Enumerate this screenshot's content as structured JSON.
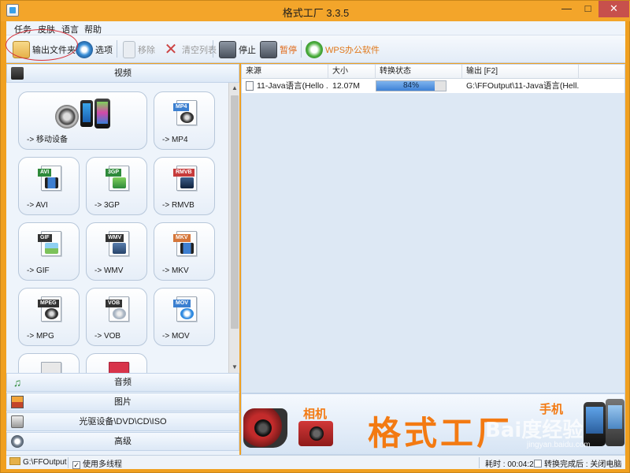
{
  "window": {
    "title": "格式工厂 3.3.5",
    "controls": {
      "minimize": "—",
      "maximize": "□",
      "close": "✕"
    }
  },
  "menu": [
    "任务",
    "皮肤",
    "语言",
    "帮助"
  ],
  "toolbar": {
    "output_folder": "输出文件夹",
    "options": "选项",
    "remove": "移除",
    "clear_list": "清空列表",
    "stop": "停止",
    "pause": "暂停",
    "wps": "WPS办公软件"
  },
  "left_panel": {
    "video_header": "视频",
    "formats": [
      {
        "label": "-> 移动设备",
        "icon": "mobile-devices-icon"
      },
      {
        "label": "-> MP4",
        "tag": "MP4",
        "tag_color": "#3b7fd0",
        "icon": "mp4-file-icon"
      },
      {
        "label": "-> AVI",
        "tag": "AVI",
        "tag_color": "#2e8a3a",
        "icon": "avi-file-icon"
      },
      {
        "label": "-> 3GP",
        "tag": "3GP",
        "tag_color": "#2e8a3a",
        "icon": "3gp-file-icon"
      },
      {
        "label": "-> RMVB",
        "tag": "RMVB",
        "tag_color": "#c63b3b",
        "icon": "rmvb-file-icon"
      },
      {
        "label": "-> GIF",
        "tag": "GIF",
        "tag_color": "#333333",
        "icon": "gif-file-icon"
      },
      {
        "label": "-> WMV",
        "tag": "WMV",
        "tag_color": "#333333",
        "icon": "wmv-file-icon"
      },
      {
        "label": "-> MKV",
        "tag": "MKV",
        "tag_color": "#d5763a",
        "icon": "mkv-file-icon"
      },
      {
        "label": "-> MPG",
        "tag": "MPEG",
        "tag_color": "#333333",
        "icon": "mpg-file-icon"
      },
      {
        "label": "-> VOB",
        "tag": "VOB",
        "tag_color": "#333333",
        "icon": "vob-file-icon"
      },
      {
        "label": "-> MOV",
        "tag": "MOV",
        "tag_color": "#3b7fd0",
        "icon": "mov-file-icon"
      }
    ],
    "audio_header": "音频",
    "picture_header": "图片",
    "disc_header": "光驱设备\\DVD\\CD\\ISO",
    "advanced_header": "高级"
  },
  "task_list": {
    "columns": [
      "来源",
      "大小",
      "转换状态",
      "输出 [F2]"
    ],
    "rows": [
      {
        "source": "11-Java语言(Hello ...",
        "size": "12.07M",
        "progress_text": "84%",
        "progress": 0.84,
        "output": "G:\\FFOutput\\11-Java语言(Hell..."
      }
    ]
  },
  "banner": {
    "camera_label": "相机",
    "main_text": "格式工厂",
    "phone_label": "手机"
  },
  "statusbar": {
    "output_path": "G:\\FFOutput",
    "multithread_label": "使用多线程",
    "elapsed": "耗时 : 00:04:20",
    "after_convert": "转换完成后 : 关闭电脑"
  },
  "watermark": {
    "main": "Bai度经验",
    "sub": "jingyan.baidu.com"
  },
  "colors": {
    "window_frame": "#f0a020",
    "accent_orange": "#f37a12",
    "progress_blue": "#3f82d6",
    "close_button": "#c7504c"
  }
}
